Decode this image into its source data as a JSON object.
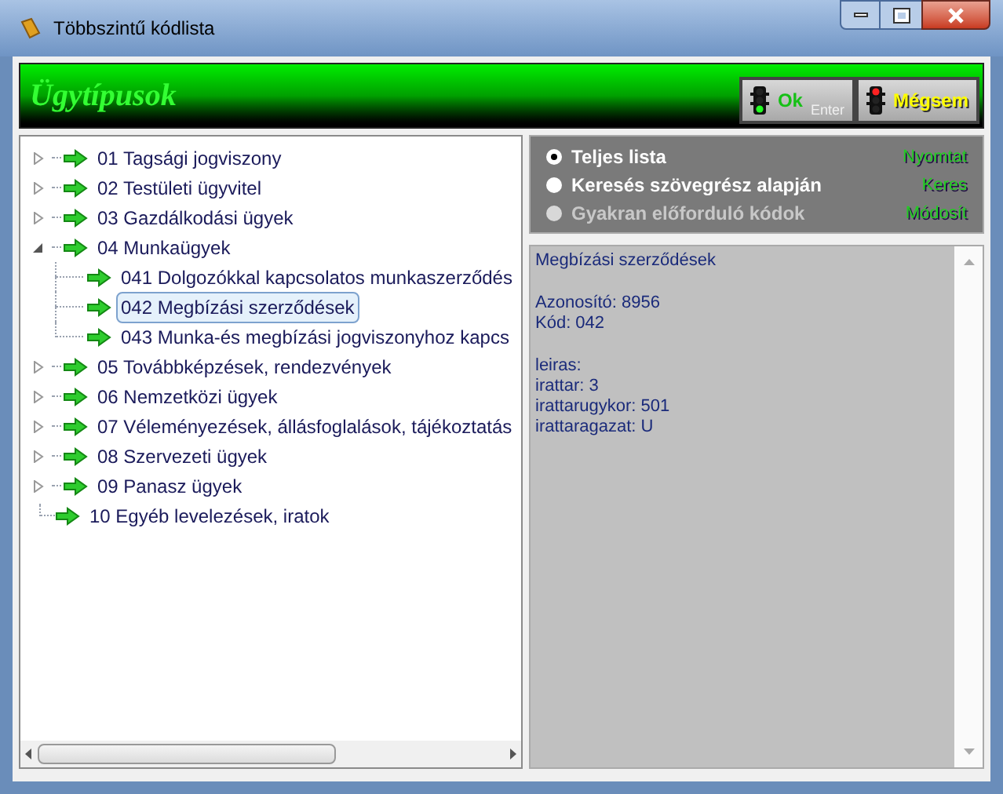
{
  "window": {
    "title": "Többszintű kódlista"
  },
  "header": {
    "title": "Ügytípusok"
  },
  "buttons": [
    {
      "label": "Ok",
      "hint": "Enter",
      "kind": "ok"
    },
    {
      "label": "Mégsem",
      "kind": "cancel"
    }
  ],
  "tree": [
    {
      "label": "01 Tagsági jogviszony",
      "expanded": false,
      "selected": false
    },
    {
      "label": "02 Testületi ügyvitel",
      "expanded": false,
      "selected": false
    },
    {
      "label": "03 Gazdálkodási ügyek",
      "expanded": false,
      "selected": false
    },
    {
      "label": "04 Munkaügyek",
      "expanded": true,
      "selected": false,
      "children": [
        {
          "label": "041 Dolgozókkal kapcsolatos munkaszerződés",
          "selected": false
        },
        {
          "label": "042 Megbízási szerződések",
          "selected": true
        },
        {
          "label": "043 Munka-és megbízási jogviszonyhoz kapcs",
          "selected": false
        }
      ]
    },
    {
      "label": "05 Továbbképzések, rendezvények",
      "expanded": false,
      "selected": false
    },
    {
      "label": "06 Nemzetközi ügyek",
      "expanded": false,
      "selected": false
    },
    {
      "label": "07 Véleményezések, állásfoglalások, tájékoztatás",
      "expanded": false,
      "selected": false
    },
    {
      "label": "08 Szervezeti ügyek",
      "expanded": false,
      "selected": false
    },
    {
      "label": "09 Panasz ügyek",
      "expanded": false,
      "selected": false
    },
    {
      "label": "10 Egyéb levelezések, iratok",
      "selected": false
    }
  ],
  "options": [
    {
      "label": "Teljes lista",
      "selected": true,
      "disabled": false
    },
    {
      "label": "Keresés szövegrész alapján",
      "selected": false,
      "disabled": false
    },
    {
      "label": "Gyakran előforduló kódok",
      "selected": false,
      "disabled": true
    }
  ],
  "actions": [
    "Nyomtat",
    "Keres",
    "Módosít"
  ],
  "details": [
    [
      "Megbízási szerződések"
    ],
    [
      "Azonosító: 8956",
      "Kód: 042"
    ],
    [
      "leiras:",
      "irattar: 3",
      "irattarugykor: 501",
      "irattaragazat: U"
    ]
  ]
}
